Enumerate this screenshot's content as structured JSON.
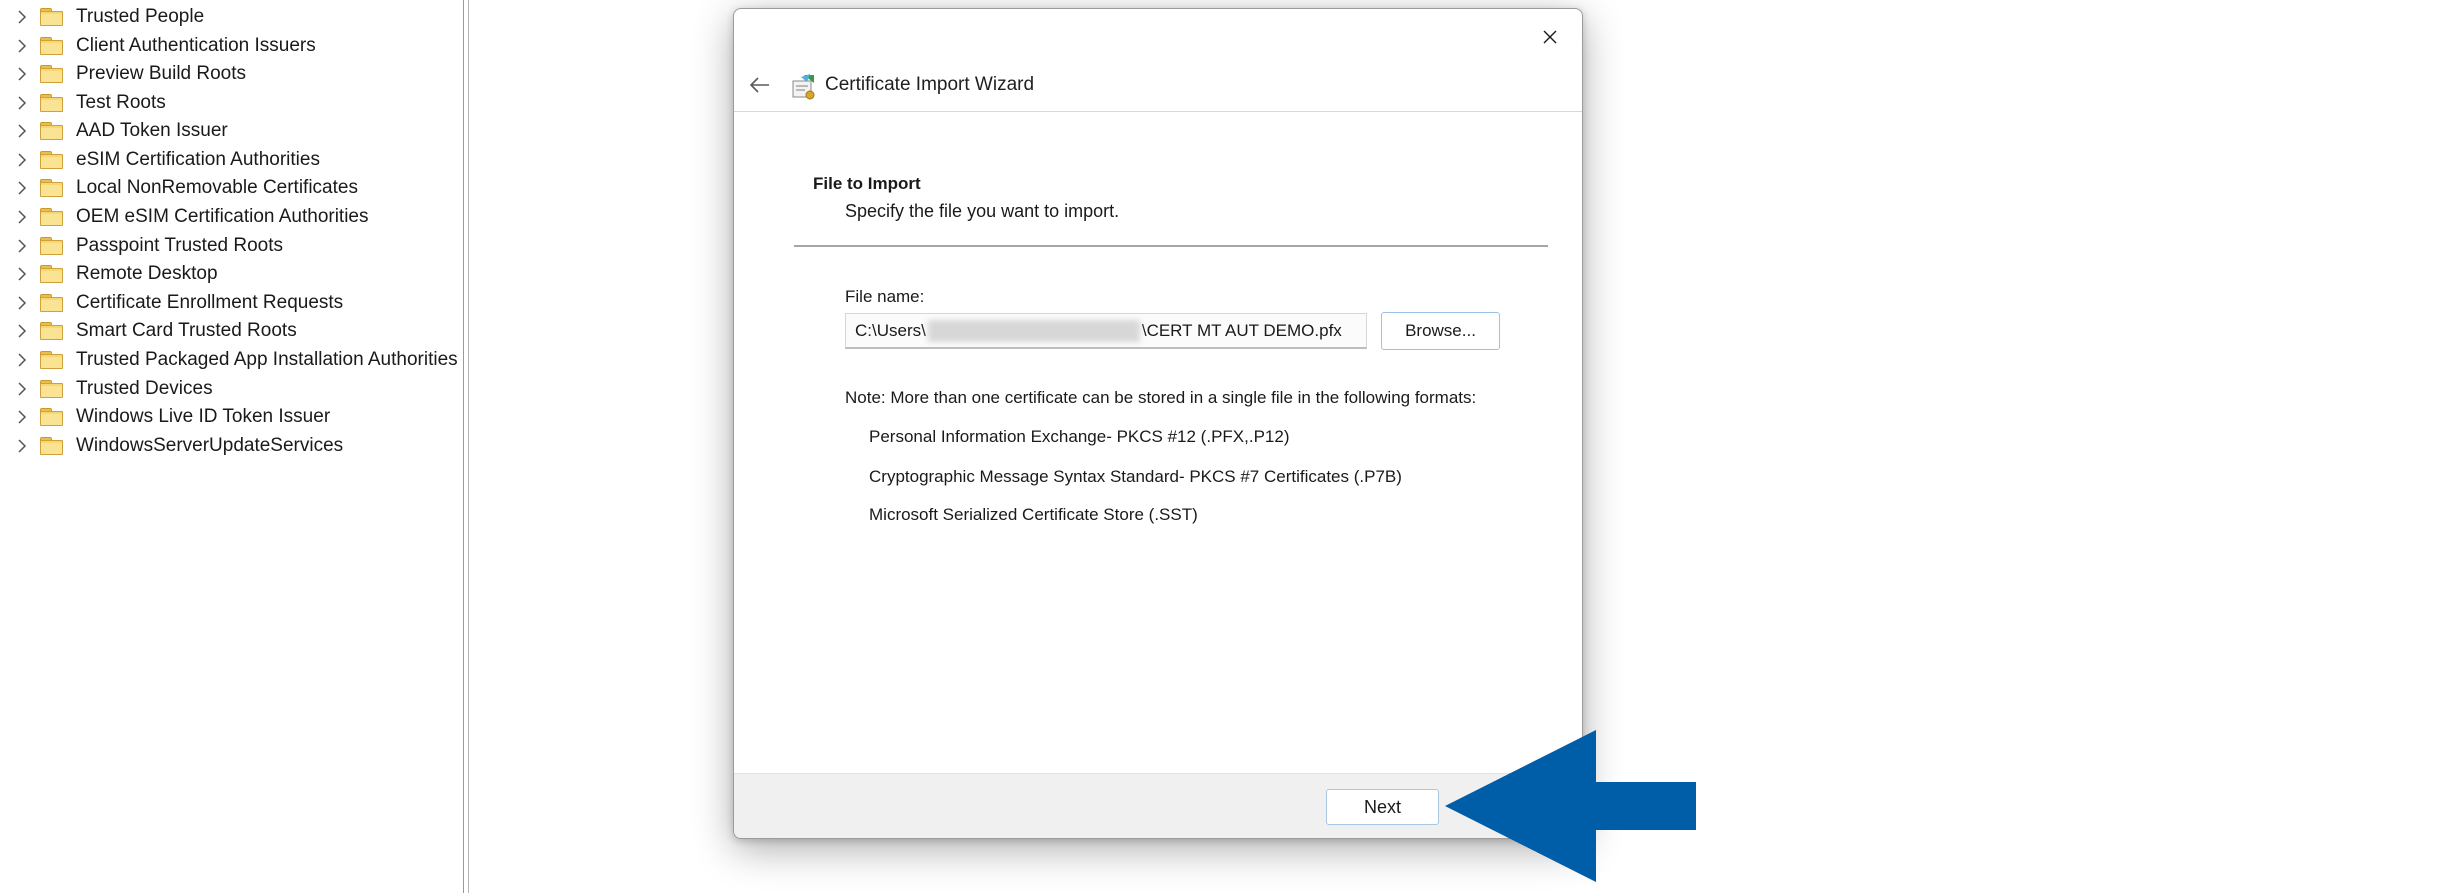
{
  "tree": {
    "items": [
      "Trusted People",
      "Client Authentication Issuers",
      "Preview Build Roots",
      "Test Roots",
      "AAD Token Issuer",
      "eSIM Certification Authorities",
      "Local NonRemovable Certificates",
      "OEM eSIM Certification Authorities",
      "Passpoint Trusted Roots",
      "Remote Desktop",
      "Certificate Enrollment Requests",
      "Smart Card Trusted Roots",
      "Trusted Packaged App Installation Authorities",
      "Trusted Devices",
      "Windows Live ID Token Issuer",
      "WindowsServerUpdateServices"
    ]
  },
  "dialog": {
    "title": "Certificate Import Wizard",
    "section_title": "File to Import",
    "section_subtitle": "Specify the file you want to import.",
    "file_label": "File name:",
    "file_path_prefix": "C:\\Users\\",
    "file_path_suffix": "\\CERT MT AUT DEMO.pfx",
    "browse_label": "Browse...",
    "note": "Note:  More than one certificate can be stored in a single file in the following formats:",
    "formats": [
      "Personal Information Exchange- PKCS #12 (.PFX,.P12)",
      "Cryptographic Message Syntax Standard- PKCS #7 Certificates (.P7B)",
      "Microsoft Serialized Certificate Store (.SST)"
    ],
    "next_label": "Next"
  },
  "colors": {
    "arrow": "#005da8",
    "folder": "#f7d774"
  }
}
